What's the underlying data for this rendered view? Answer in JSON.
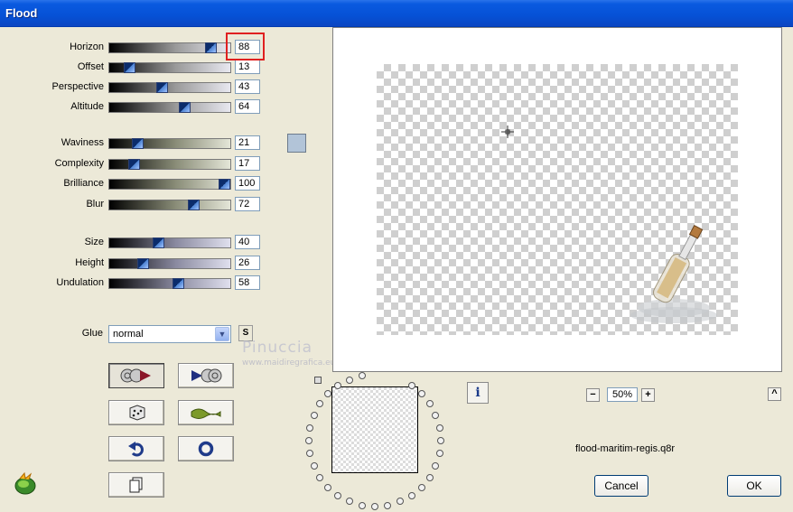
{
  "window": {
    "title": "Flood"
  },
  "params": [
    {
      "id": "horizon",
      "label": "Horizon",
      "value": "88",
      "fraction": 0.88,
      "track": "gray"
    },
    {
      "id": "offset",
      "label": "Offset",
      "value": "13",
      "fraction": 0.13,
      "track": "gray"
    },
    {
      "id": "perspective",
      "label": "Perspective",
      "value": "43",
      "fraction": 0.43,
      "track": "gray"
    },
    {
      "id": "altitude",
      "label": "Altitude",
      "value": "64",
      "fraction": 0.64,
      "track": "gray"
    },
    {
      "id": "waviness",
      "label": "Waviness",
      "value": "21",
      "fraction": 0.21,
      "track": "green"
    },
    {
      "id": "complexity",
      "label": "Complexity",
      "value": "17",
      "fraction": 0.17,
      "track": "green"
    },
    {
      "id": "brilliance",
      "label": "Brilliance",
      "value": "100",
      "fraction": 1.0,
      "track": "green"
    },
    {
      "id": "blur",
      "label": "Blur",
      "value": "72",
      "fraction": 0.72,
      "track": "green"
    },
    {
      "id": "size",
      "label": "Size",
      "value": "40",
      "fraction": 0.4,
      "track": "blue"
    },
    {
      "id": "height",
      "label": "Height",
      "value": "26",
      "fraction": 0.26,
      "track": "blue"
    },
    {
      "id": "undulation",
      "label": "Undulation",
      "value": "58",
      "fraction": 0.58,
      "track": "blue"
    }
  ],
  "flood_color": "#b2c4d8",
  "glue": {
    "label": "Glue",
    "value": "normal"
  },
  "s_button": "S",
  "watermark": {
    "name": "Pinuccia",
    "site": "www.maidiregrafica.eu"
  },
  "zoom": {
    "value": "50%",
    "minus": "−",
    "plus": "+"
  },
  "info_label": "i",
  "collapse_label": "^",
  "filename": "flood-maritim-regis.q8r",
  "buttons": {
    "cancel": "Cancel",
    "ok": "OK"
  },
  "icons": {
    "random": "dice-icon",
    "reset": "undo-icon",
    "default": "circle-icon",
    "copy": "copy-icon",
    "wave": "wave-icon",
    "load": "load-preset-icon",
    "save": "save-preset-icon"
  }
}
